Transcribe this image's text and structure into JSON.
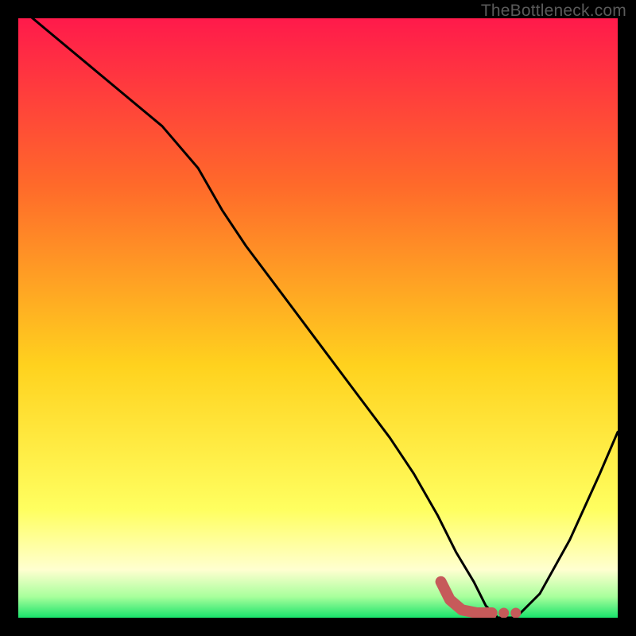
{
  "watermark": "TheBottleneck.com",
  "colors": {
    "gradient_top": "#ff1a4b",
    "gradient_mid_upper": "#ff6a2a",
    "gradient_mid": "#ffd21e",
    "gradient_lower": "#ffff60",
    "gradient_pale": "#ffffd0",
    "gradient_green_light": "#a8ff9c",
    "gradient_green": "#19e36b",
    "curve": "#000000",
    "marker": "#c65a5a",
    "frame": "#000000"
  },
  "chart_data": {
    "type": "line",
    "title": "",
    "xlabel": "",
    "ylabel": "",
    "xlim": [
      0,
      100
    ],
    "ylim": [
      0,
      100
    ],
    "series": [
      {
        "name": "bottleneck-curve",
        "x": [
          0,
          6,
          12,
          18,
          24,
          30,
          34,
          38,
          44,
          50,
          56,
          62,
          66,
          70,
          73,
          76,
          78,
          80,
          83,
          87,
          92,
          97,
          100
        ],
        "y": [
          102,
          97,
          92,
          87,
          82,
          75,
          68,
          62,
          54,
          46,
          38,
          30,
          24,
          17,
          11,
          6,
          2,
          0,
          0,
          4,
          13,
          24,
          31
        ]
      }
    ],
    "markers": [
      {
        "name": "range-highlight",
        "points": [
          {
            "x": 70.5,
            "y": 6.0
          },
          {
            "x": 72.0,
            "y": 3.0
          },
          {
            "x": 74.0,
            "y": 1.3
          },
          {
            "x": 76.5,
            "y": 0.8
          },
          {
            "x": 79.0,
            "y": 0.8
          }
        ],
        "dots": [
          {
            "x": 81.0,
            "y": 0.8
          },
          {
            "x": 83.0,
            "y": 0.8
          }
        ]
      }
    ]
  }
}
